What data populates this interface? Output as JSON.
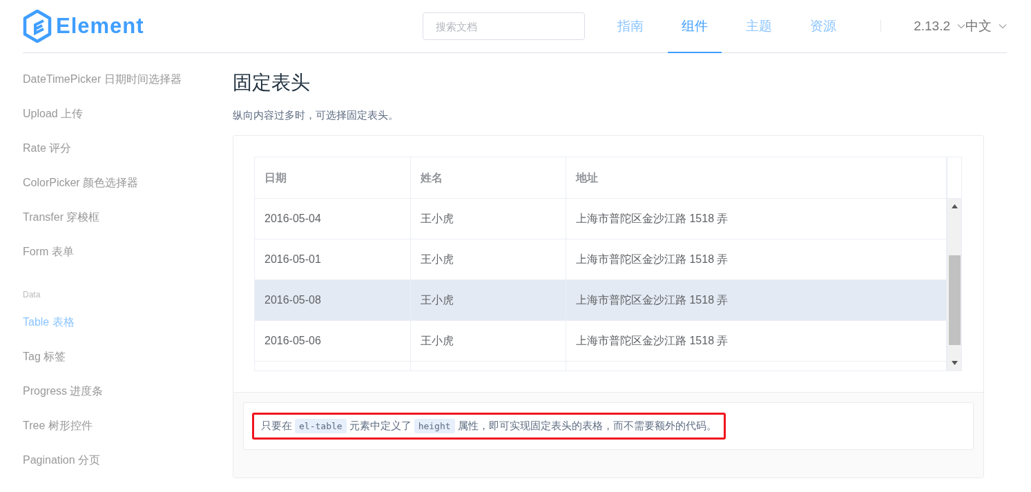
{
  "header": {
    "logo_text": "Element",
    "search": {
      "placeholder": "搜索文档"
    },
    "nav": [
      {
        "label": "指南",
        "selected": false
      },
      {
        "label": "组件",
        "selected": true
      },
      {
        "label": "主题",
        "selected": false
      },
      {
        "label": "资源",
        "selected": false
      }
    ],
    "version": "2.13.2",
    "language": "中文"
  },
  "sidebar": {
    "items": [
      {
        "kind": "link",
        "label": "DateTimePicker 日期时间选择器",
        "selected": false
      },
      {
        "kind": "link",
        "label": "Upload 上传",
        "selected": false
      },
      {
        "kind": "link",
        "label": "Rate 评分",
        "selected": false
      },
      {
        "kind": "link",
        "label": "ColorPicker 颜色选择器",
        "selected": false
      },
      {
        "kind": "link",
        "label": "Transfer 穿梭框",
        "selected": false
      },
      {
        "kind": "link",
        "label": "Form 表单",
        "selected": false
      },
      {
        "kind": "group",
        "label": "Data"
      },
      {
        "kind": "link",
        "label": "Table 表格",
        "selected": true
      },
      {
        "kind": "link",
        "label": "Tag 标签",
        "selected": false
      },
      {
        "kind": "link",
        "label": "Progress 进度条",
        "selected": false
      },
      {
        "kind": "link",
        "label": "Tree 树形控件",
        "selected": false
      },
      {
        "kind": "link",
        "label": "Pagination 分页",
        "selected": false
      }
    ]
  },
  "section": {
    "title": "固定表头",
    "subtitle": "纵向内容过多时，可选择固定表头。",
    "table": {
      "columns": [
        "日期",
        "姓名",
        "地址"
      ],
      "rows": [
        {
          "cells": [
            "2016-05-04",
            "王小虎",
            "上海市普陀区金沙江路 1518 弄"
          ],
          "highlighted": false
        },
        {
          "cells": [
            "2016-05-01",
            "王小虎",
            "上海市普陀区金沙江路 1518 弄"
          ],
          "highlighted": false
        },
        {
          "cells": [
            "2016-05-08",
            "王小虎",
            "上海市普陀区金沙江路 1518 弄"
          ],
          "highlighted": true
        },
        {
          "cells": [
            "2016-05-06",
            "王小虎",
            "上海市普陀区金沙江路 1518 弄"
          ],
          "highlighted": false
        }
      ]
    },
    "description": {
      "annotated": true,
      "parts": [
        {
          "kind": "text",
          "text": "只要在"
        },
        {
          "kind": "code",
          "text": "el-table"
        },
        {
          "kind": "text",
          "text": "元素中定义了"
        },
        {
          "kind": "code",
          "text": "height"
        },
        {
          "kind": "text",
          "text": "属性，即可实现固定表头的表格，而不需要额外的代码。"
        }
      ]
    }
  }
}
